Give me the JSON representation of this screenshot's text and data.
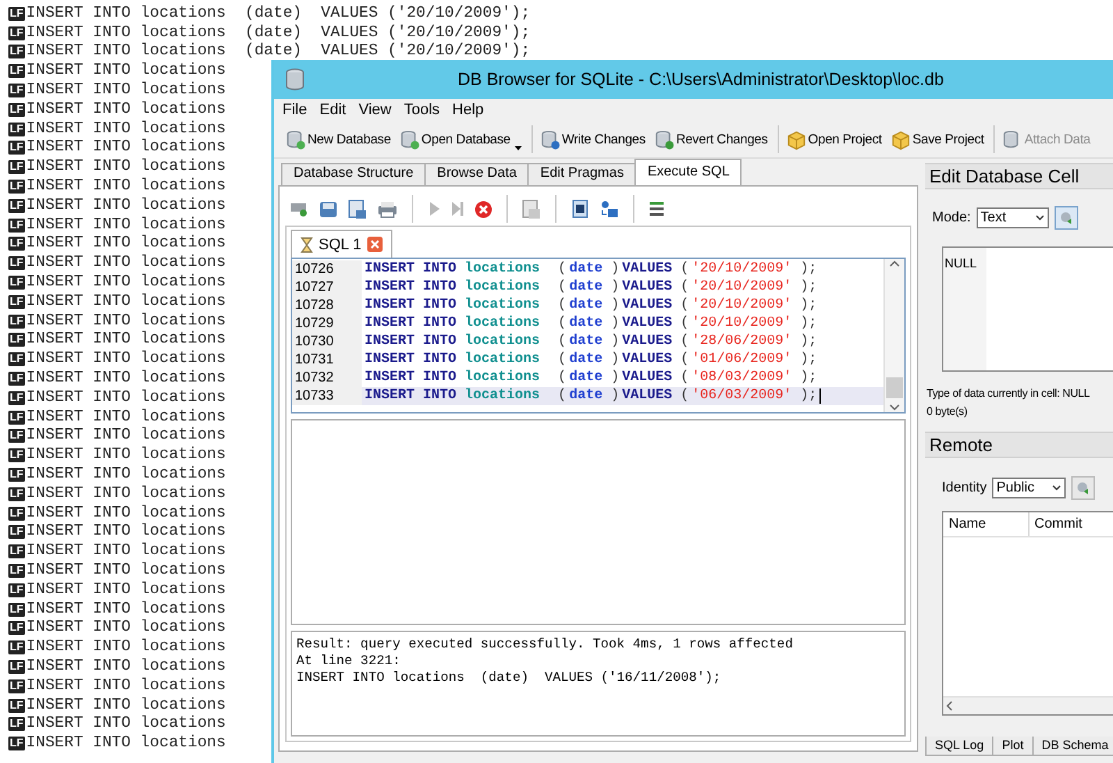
{
  "background_editor": {
    "lines": [
      {
        "marker": "LF",
        "text": "INSERT INTO locations  (date)  VALUES ('20/10/2009');"
      },
      {
        "marker": "LF",
        "text": "INSERT INTO locations  (date)  VALUES ('20/10/2009');"
      },
      {
        "marker": "LF",
        "text": "INSERT INTO locations  (date)  VALUES ('20/10/2009');"
      },
      {
        "marker": "LF",
        "text": "INSERT INTO locations"
      },
      {
        "marker": "LF",
        "text": "INSERT INTO locations"
      },
      {
        "marker": "LF",
        "text": "INSERT INTO locations"
      },
      {
        "marker": "LF",
        "text": "INSERT INTO locations"
      },
      {
        "marker": "LF",
        "text": "INSERT INTO locations"
      },
      {
        "marker": "LF",
        "text": "INSERT INTO locations"
      },
      {
        "marker": "LF",
        "text": "INSERT INTO locations"
      },
      {
        "marker": "LF",
        "text": "INSERT INTO locations"
      },
      {
        "marker": "LF",
        "text": "INSERT INTO locations"
      },
      {
        "marker": "LF",
        "text": "INSERT INTO locations"
      },
      {
        "marker": "LF",
        "text": "INSERT INTO locations"
      },
      {
        "marker": "LF",
        "text": "INSERT INTO locations"
      },
      {
        "marker": "LF",
        "text": "INSERT INTO locations"
      },
      {
        "marker": "LF",
        "text": "INSERT INTO locations"
      },
      {
        "marker": "LF",
        "text": "INSERT INTO locations"
      },
      {
        "marker": "LF",
        "text": "INSERT INTO locations"
      },
      {
        "marker": "LF",
        "text": "INSERT INTO locations"
      },
      {
        "marker": "LF",
        "text": "INSERT INTO locations"
      },
      {
        "marker": "LF",
        "text": "INSERT INTO locations"
      },
      {
        "marker": "LF",
        "text": "INSERT INTO locations"
      },
      {
        "marker": "LF",
        "text": "INSERT INTO locations"
      },
      {
        "marker": "LF",
        "text": "INSERT INTO locations"
      },
      {
        "marker": "LF",
        "text": "INSERT INTO locations"
      },
      {
        "marker": "LF",
        "text": "INSERT INTO locations"
      },
      {
        "marker": "LF",
        "text": "INSERT INTO locations"
      },
      {
        "marker": "LF",
        "text": "INSERT INTO locations"
      },
      {
        "marker": "LF",
        "text": "INSERT INTO locations"
      },
      {
        "marker": "LF",
        "text": "INSERT INTO locations"
      },
      {
        "marker": "LF",
        "text": "INSERT INTO locations"
      },
      {
        "marker": "LF",
        "text": "INSERT INTO locations"
      },
      {
        "marker": "LF",
        "text": "INSERT INTO locations"
      },
      {
        "marker": "LF",
        "text": "INSERT INTO locations"
      },
      {
        "marker": "LF",
        "text": "INSERT INTO locations"
      },
      {
        "marker": "LF",
        "text": "INSERT INTO locations"
      },
      {
        "marker": "LF",
        "text": "INSERT INTO locations"
      },
      {
        "marker": "LF",
        "text": "INSERT INTO locations"
      }
    ]
  },
  "window": {
    "title": "DB Browser for SQLite - C:\\Users\\Administrator\\Desktop\\loc.db",
    "menu": [
      "File",
      "Edit",
      "View",
      "Tools",
      "Help"
    ],
    "toolbar": [
      {
        "label": "New Database",
        "disabled": false,
        "dropdown": false
      },
      {
        "label": "Open Database",
        "disabled": false,
        "dropdown": true
      },
      {
        "label": "Write Changes",
        "disabled": false,
        "dropdown": false
      },
      {
        "label": "Revert Changes",
        "disabled": false,
        "dropdown": false
      },
      {
        "label": "Open Project",
        "disabled": false,
        "dropdown": false
      },
      {
        "label": "Save Project",
        "disabled": false,
        "dropdown": false
      },
      {
        "label": "Attach Data",
        "disabled": true,
        "dropdown": false
      }
    ],
    "tabs": [
      {
        "label": "Database Structure",
        "selected": false
      },
      {
        "label": "Browse Data",
        "selected": false
      },
      {
        "label": "Edit Pragmas",
        "selected": false
      },
      {
        "label": "Execute SQL",
        "selected": true
      }
    ],
    "editor_tabs": [
      {
        "label": "SQL 1",
        "selected": true
      }
    ],
    "editor": {
      "lines": [
        {
          "number": "10726",
          "current": false,
          "tokens": [
            {
              "kind": "keyword",
              "text": "INSERT"
            },
            {
              "kind": "keyword",
              "text": "INTO"
            },
            {
              "kind": "table",
              "text": "locations"
            },
            {
              "kind": "punct",
              "text": "("
            },
            {
              "kind": "column",
              "text": "date"
            },
            {
              "kind": "punct",
              "text": ")"
            },
            {
              "kind": "keyword",
              "text": "VALUES"
            },
            {
              "kind": "punct",
              "text": "("
            },
            {
              "kind": "string",
              "text": "'20/10/2009'"
            },
            {
              "kind": "punct",
              "text": ");"
            }
          ]
        },
        {
          "number": "10727",
          "current": false,
          "tokens": [
            {
              "kind": "keyword",
              "text": "INSERT"
            },
            {
              "kind": "keyword",
              "text": "INTO"
            },
            {
              "kind": "table",
              "text": "locations"
            },
            {
              "kind": "punct",
              "text": "("
            },
            {
              "kind": "column",
              "text": "date"
            },
            {
              "kind": "punct",
              "text": ")"
            },
            {
              "kind": "keyword",
              "text": "VALUES"
            },
            {
              "kind": "punct",
              "text": "("
            },
            {
              "kind": "string",
              "text": "'20/10/2009'"
            },
            {
              "kind": "punct",
              "text": ");"
            }
          ]
        },
        {
          "number": "10728",
          "current": false,
          "tokens": [
            {
              "kind": "keyword",
              "text": "INSERT"
            },
            {
              "kind": "keyword",
              "text": "INTO"
            },
            {
              "kind": "table",
              "text": "locations"
            },
            {
              "kind": "punct",
              "text": "("
            },
            {
              "kind": "column",
              "text": "date"
            },
            {
              "kind": "punct",
              "text": ")"
            },
            {
              "kind": "keyword",
              "text": "VALUES"
            },
            {
              "kind": "punct",
              "text": "("
            },
            {
              "kind": "string",
              "text": "'20/10/2009'"
            },
            {
              "kind": "punct",
              "text": ");"
            }
          ]
        },
        {
          "number": "10729",
          "current": false,
          "tokens": [
            {
              "kind": "keyword",
              "text": "INSERT"
            },
            {
              "kind": "keyword",
              "text": "INTO"
            },
            {
              "kind": "table",
              "text": "locations"
            },
            {
              "kind": "punct",
              "text": "("
            },
            {
              "kind": "column",
              "text": "date"
            },
            {
              "kind": "punct",
              "text": ")"
            },
            {
              "kind": "keyword",
              "text": "VALUES"
            },
            {
              "kind": "punct",
              "text": "("
            },
            {
              "kind": "string",
              "text": "'20/10/2009'"
            },
            {
              "kind": "punct",
              "text": ");"
            }
          ]
        },
        {
          "number": "10730",
          "current": false,
          "tokens": [
            {
              "kind": "keyword",
              "text": "INSERT"
            },
            {
              "kind": "keyword",
              "text": "INTO"
            },
            {
              "kind": "table",
              "text": "locations"
            },
            {
              "kind": "punct",
              "text": "("
            },
            {
              "kind": "column",
              "text": "date"
            },
            {
              "kind": "punct",
              "text": ")"
            },
            {
              "kind": "keyword",
              "text": "VALUES"
            },
            {
              "kind": "punct",
              "text": "("
            },
            {
              "kind": "string",
              "text": "'28/06/2009'"
            },
            {
              "kind": "punct",
              "text": ");"
            }
          ]
        },
        {
          "number": "10731",
          "current": false,
          "tokens": [
            {
              "kind": "keyword",
              "text": "INSERT"
            },
            {
              "kind": "keyword",
              "text": "INTO"
            },
            {
              "kind": "table",
              "text": "locations"
            },
            {
              "kind": "punct",
              "text": "("
            },
            {
              "kind": "column",
              "text": "date"
            },
            {
              "kind": "punct",
              "text": ")"
            },
            {
              "kind": "keyword",
              "text": "VALUES"
            },
            {
              "kind": "punct",
              "text": "("
            },
            {
              "kind": "string",
              "text": "'01/06/2009'"
            },
            {
              "kind": "punct",
              "text": ");"
            }
          ]
        },
        {
          "number": "10732",
          "current": false,
          "tokens": [
            {
              "kind": "keyword",
              "text": "INSERT"
            },
            {
              "kind": "keyword",
              "text": "INTO"
            },
            {
              "kind": "table",
              "text": "locations"
            },
            {
              "kind": "punct",
              "text": "("
            },
            {
              "kind": "column",
              "text": "date"
            },
            {
              "kind": "punct",
              "text": ")"
            },
            {
              "kind": "keyword",
              "text": "VALUES"
            },
            {
              "kind": "punct",
              "text": "("
            },
            {
              "kind": "string",
              "text": "'08/03/2009'"
            },
            {
              "kind": "punct",
              "text": ");"
            }
          ]
        },
        {
          "number": "10733",
          "current": true,
          "tokens": [
            {
              "kind": "keyword",
              "text": "INSERT"
            },
            {
              "kind": "keyword",
              "text": "INTO"
            },
            {
              "kind": "table",
              "text": "locations"
            },
            {
              "kind": "punct",
              "text": "("
            },
            {
              "kind": "column",
              "text": "date"
            },
            {
              "kind": "punct",
              "text": ")"
            },
            {
              "kind": "keyword",
              "text": "VALUES"
            },
            {
              "kind": "punct",
              "text": "("
            },
            {
              "kind": "string",
              "text": "'06/03/2009'"
            },
            {
              "kind": "punct",
              "text": ");"
            }
          ]
        }
      ]
    },
    "message": [
      "Result: query executed successfully. Took 4ms, 1 rows affected",
      "At line 3221:",
      "INSERT INTO locations  (date)  VALUES ('16/11/2008');"
    ],
    "edit_cell": {
      "title": "Edit Database Cell",
      "mode_label": "Mode:",
      "mode": "Text",
      "value": "NULL",
      "type_info": "Type of data currently in cell: NULL",
      "size_info": "0 byte(s)"
    },
    "remote": {
      "title": "Remote",
      "identity_label": "Identity",
      "identity": "Public",
      "columns": [
        "Name",
        "Commit"
      ]
    },
    "dock_tabs": [
      {
        "label": "SQL Log",
        "selected": false
      },
      {
        "label": "Plot",
        "selected": false
      },
      {
        "label": "DB Schema",
        "selected": false
      }
    ]
  }
}
